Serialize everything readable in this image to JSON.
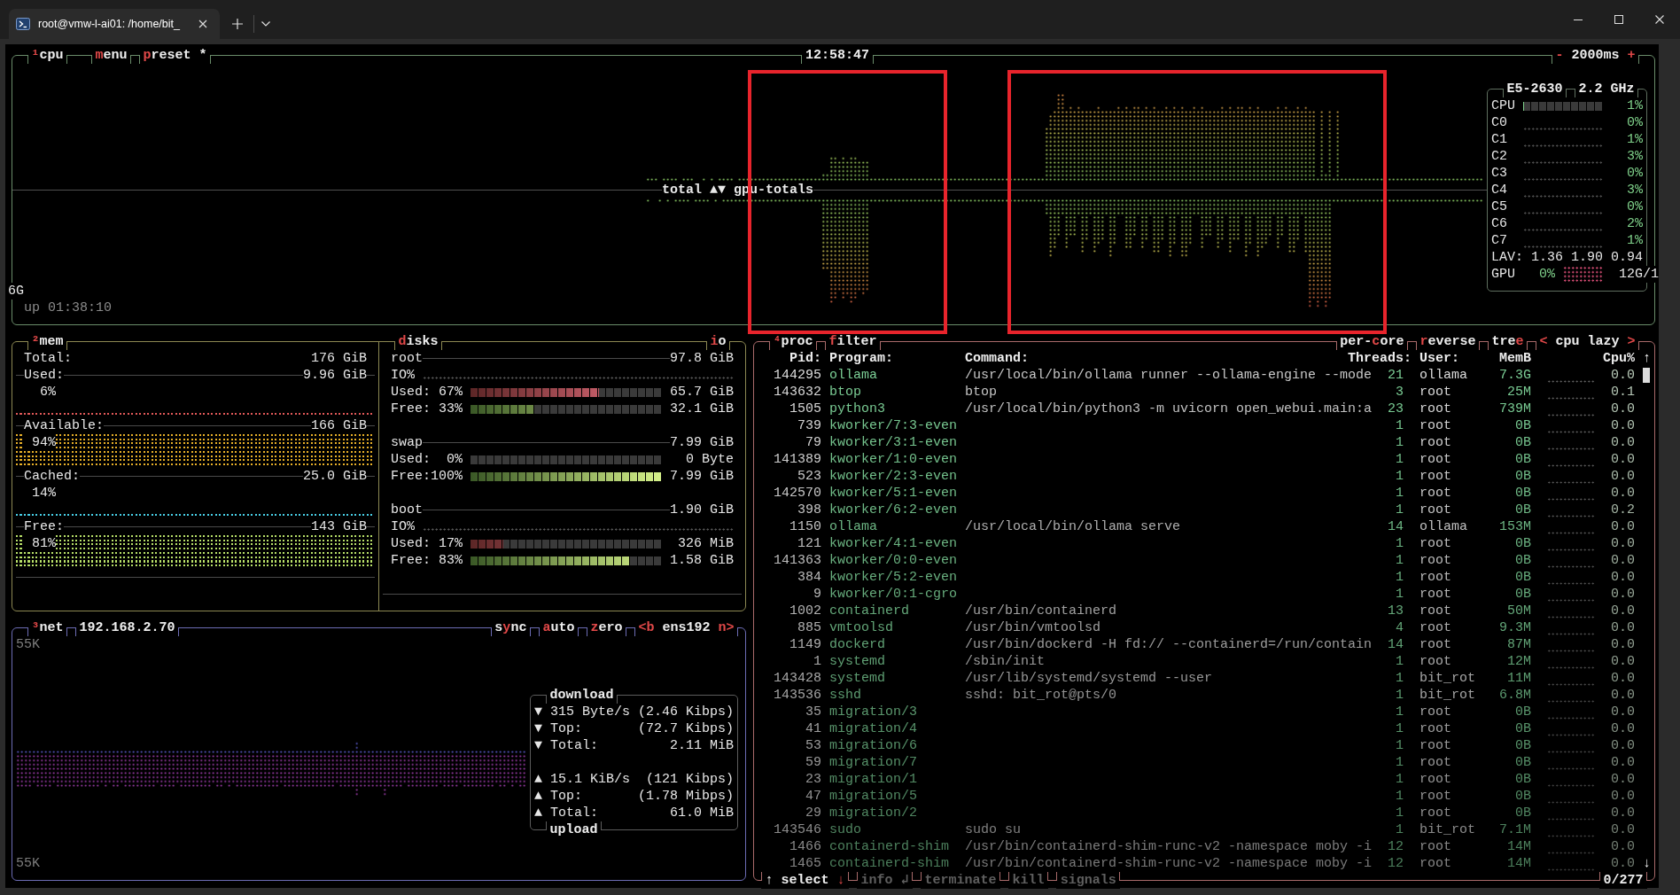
{
  "window": {
    "tabs": [
      {
        "title": "root@vmw-l-ai01: /home/bit_",
        "selected": true
      }
    ]
  },
  "cpu": {
    "titles": [
      {
        "parts": [
          {
            "text": "¹",
            "hot": true
          },
          {
            "text": "cpu",
            "hot": false
          }
        ]
      },
      {
        "parts": [
          {
            "text": "m",
            "hot": true
          },
          {
            "text": "enu",
            "hot": false
          }
        ]
      },
      {
        "parts": [
          {
            "text": "p",
            "hot": true
          },
          {
            "text": "reset *",
            "hot": false
          }
        ]
      }
    ],
    "clock": "12:58:47",
    "interval": {
      "parts": [
        {
          "text": "-",
          "hot": true
        },
        {
          "text": " 2000ms ",
          "hot": false
        },
        {
          "text": "+",
          "hot": true
        }
      ]
    },
    "graph": {
      "upper_label": "total",
      "toggle": "▲▼",
      "lower_label": "gpu-totals",
      "scale": "6G"
    },
    "uptime": "up 01:38:10",
    "model": "E5-2630",
    "frequency": "2.2 GHz",
    "total": {
      "label": "CPU",
      "level": 0.01,
      "percent": "1%"
    },
    "cores": [
      {
        "label": "C0",
        "percent": "0%"
      },
      {
        "label": "C1",
        "percent": "1%"
      },
      {
        "label": "C2",
        "percent": "3%"
      },
      {
        "label": "C3",
        "percent": "0%"
      },
      {
        "label": "C4",
        "percent": "3%"
      },
      {
        "label": "C5",
        "percent": "0%"
      },
      {
        "label": "C6",
        "percent": "2%"
      },
      {
        "label": "C7",
        "percent": "1%"
      }
    ],
    "load": {
      "label": "LAV:",
      "values": [
        "1.36",
        "1.90",
        "0.94"
      ]
    },
    "gpu": {
      "label": "GPU",
      "percent": "0%",
      "memory": "12G/1"
    }
  },
  "memory": {
    "title": {
      "parts": [
        {
          "text": "²",
          "hot": true
        },
        {
          "text": "mem",
          "hot": false
        }
      ]
    },
    "total": {
      "label": "Total:",
      "value": "176 GiB"
    },
    "meters": [
      {
        "label": "Used:",
        "value": "9.96 GiB",
        "percent": "6%",
        "color": "#e05858"
      },
      {
        "label": "Available:",
        "value": "166 GiB",
        "percent": "94%",
        "color": "#e8b028"
      },
      {
        "label": "Cached:",
        "value": "25.0 GiB",
        "percent": "14%",
        "color": "#48d0e8"
      },
      {
        "label": "Free:",
        "value": "143 GiB",
        "percent": "81%",
        "color": "#b8e068"
      }
    ]
  },
  "disks": {
    "title": {
      "parts": [
        {
          "text": "d",
          "hot": true
        },
        {
          "text": "isks",
          "hot": false
        }
      ]
    },
    "io_toggle": {
      "parts": [
        {
          "text": "i",
          "hot": true
        },
        {
          "text": "o",
          "hot": false
        }
      ]
    },
    "items": [
      {
        "name": "root",
        "size": "97.8 GiB",
        "io_label": "IO%",
        "bars": [
          {
            "kind": "used",
            "label": "Used:",
            "percent": "67%",
            "level": 0.67,
            "value": "65.7 GiB"
          },
          {
            "kind": "free",
            "label": "Free:",
            "percent": "33%",
            "level": 0.33,
            "value": "32.1 GiB"
          }
        ]
      },
      {
        "name": "swap",
        "size": "7.99 GiB",
        "bars": [
          {
            "kind": "used",
            "label": "Used:",
            "percent": "0%",
            "value": "0 Byte"
          },
          {
            "kind": "free",
            "label": "Free:",
            "percent": "100%",
            "level": 1,
            "value": "7.99 GiB"
          }
        ]
      },
      {
        "name": "boot",
        "size": "1.90 GiB",
        "io_label": "IO%",
        "bars": [
          {
            "kind": "used",
            "label": "Used:",
            "percent": "17%",
            "level": 0.17,
            "value": "326 MiB"
          },
          {
            "kind": "free",
            "label": "Free:",
            "percent": "83%",
            "level": 0.83,
            "value": "1.58 GiB"
          }
        ]
      }
    ]
  },
  "net": {
    "title": {
      "parts": [
        {
          "text": "³",
          "hot": true
        },
        {
          "text": "net",
          "hot": false
        }
      ]
    },
    "address": "192.168.2.70",
    "toggles": [
      {
        "parts": [
          {
            "text": "s",
            "hot": false
          },
          {
            "text": "y",
            "hot": true
          },
          {
            "text": "nc",
            "hot": false
          }
        ]
      },
      {
        "parts": [
          {
            "text": "a",
            "hot": true
          },
          {
            "text": "uto",
            "hot": false
          }
        ]
      },
      {
        "parts": [
          {
            "text": "z",
            "hot": true
          },
          {
            "text": "ero",
            "hot": false
          }
        ]
      },
      {
        "parts": [
          {
            "text": "<b",
            "hot": true
          },
          {
            "text": " ens192 ",
            "hot": false
          },
          {
            "text": "n>",
            "hot": true
          }
        ]
      }
    ],
    "scale_top": "55K",
    "scale_bottom": "55K",
    "download": {
      "title": "download",
      "rows": [
        {
          "arrow": "▼",
          "label": "315 Byte/s",
          "value": "(2.46 Kibps)"
        },
        {
          "arrow": "▼",
          "label": "Top:",
          "value": "(72.7 Kibps)"
        },
        {
          "arrow": "▼",
          "label": "Total:",
          "value": "2.11 MiB"
        }
      ]
    },
    "upload": {
      "title": "upload",
      "rows": [
        {
          "arrow": "▲",
          "label": "15.1 KiB/s",
          "value": "(121 Kibps)"
        },
        {
          "arrow": "▲",
          "label": "Top:",
          "value": "(1.78 Mibps)"
        },
        {
          "arrow": "▲",
          "label": "Total:",
          "value": "61.0 MiB"
        }
      ]
    }
  },
  "processes": {
    "titles_left": [
      {
        "parts": [
          {
            "text": "⁴",
            "hot": true
          },
          {
            "text": "proc",
            "hot": false
          }
        ]
      },
      {
        "parts": [
          {
            "text": "f",
            "hot": true
          },
          {
            "text": "ilter",
            "hot": false
          }
        ]
      }
    ],
    "titles_right": [
      {
        "parts": [
          {
            "text": "per-",
            "hot": false
          },
          {
            "text": "c",
            "hot": true
          },
          {
            "text": "ore",
            "hot": false
          }
        ]
      },
      {
        "parts": [
          {
            "text": "r",
            "hot": true
          },
          {
            "text": "everse",
            "hot": false
          }
        ]
      },
      {
        "parts": [
          {
            "text": "tre",
            "hot": false
          },
          {
            "text": "e",
            "hot": true
          }
        ]
      },
      {
        "parts": [
          {
            "text": "<",
            "hot": true
          },
          {
            "text": " cpu lazy ",
            "hot": false
          },
          {
            "text": ">",
            "hot": true
          }
        ]
      }
    ],
    "columns": [
      "Pid:",
      "Program:",
      "Command:",
      "Threads:",
      "User:",
      "MemB",
      "Cpu%"
    ],
    "scroll_up": "↑",
    "scroll_down": "↓",
    "rows": [
      {
        "pid": "144295",
        "program": "ollama",
        "command": "/usr/local/bin/ollama runner --ollama-engine --mode",
        "threads": "21",
        "user": "ollama",
        "mem": "7.3G",
        "cpu": "0.0"
      },
      {
        "pid": "143632",
        "program": "btop",
        "command": "btop",
        "threads": "3",
        "user": "root",
        "mem": "25M",
        "cpu": "0.1"
      },
      {
        "pid": "1505",
        "program": "python3",
        "command": "/usr/local/bin/python3 -m uvicorn open_webui.main:a",
        "threads": "23",
        "user": "root",
        "mem": "739M",
        "cpu": "0.0"
      },
      {
        "pid": "739",
        "program": "kworker/7:3-even",
        "threads": "1",
        "user": "root",
        "mem": "0B",
        "cpu": "0.0"
      },
      {
        "pid": "79",
        "program": "kworker/3:1-even",
        "threads": "1",
        "user": "root",
        "mem": "0B",
        "cpu": "0.0"
      },
      {
        "pid": "141389",
        "program": "kworker/1:0-even",
        "threads": "1",
        "user": "root",
        "mem": "0B",
        "cpu": "0.0"
      },
      {
        "pid": "523",
        "program": "kworker/2:3-even",
        "threads": "1",
        "user": "root",
        "mem": "0B",
        "cpu": "0.0"
      },
      {
        "pid": "142570",
        "program": "kworker/5:1-even",
        "threads": "1",
        "user": "root",
        "mem": "0B",
        "cpu": "0.0"
      },
      {
        "pid": "398",
        "program": "kworker/6:2-even",
        "threads": "1",
        "user": "root",
        "mem": "0B",
        "cpu": "0.2"
      },
      {
        "pid": "1150",
        "program": "ollama",
        "command": "/usr/local/bin/ollama serve",
        "threads": "14",
        "user": "ollama",
        "mem": "153M",
        "cpu": "0.0"
      },
      {
        "pid": "121",
        "program": "kworker/4:1-even",
        "threads": "1",
        "user": "root",
        "mem": "0B",
        "cpu": "0.0"
      },
      {
        "pid": "141363",
        "program": "kworker/0:0-even",
        "threads": "1",
        "user": "root",
        "mem": "0B",
        "cpu": "0.0"
      },
      {
        "pid": "384",
        "program": "kworker/5:2-even",
        "threads": "1",
        "user": "root",
        "mem": "0B",
        "cpu": "0.0"
      },
      {
        "pid": "9",
        "program": "kworker/0:1-cgro",
        "threads": "1",
        "user": "root",
        "mem": "0B",
        "cpu": "0.0"
      },
      {
        "pid": "1002",
        "program": "containerd",
        "command": "/usr/bin/containerd",
        "threads": "13",
        "user": "root",
        "mem": "50M",
        "cpu": "0.0"
      },
      {
        "pid": "885",
        "program": "vmtoolsd",
        "command": "/usr/bin/vmtoolsd",
        "threads": "4",
        "user": "root",
        "mem": "9.3M",
        "cpu": "0.0"
      },
      {
        "pid": "1149",
        "program": "dockerd",
        "command": "/usr/bin/dockerd -H fd:// --containerd=/run/contain",
        "threads": "14",
        "user": "root",
        "mem": "87M",
        "cpu": "0.0"
      },
      {
        "pid": "1",
        "program": "systemd",
        "command": "/sbin/init",
        "threads": "1",
        "user": "root",
        "mem": "12M",
        "cpu": "0.0"
      },
      {
        "pid": "143428",
        "program": "systemd",
        "command": "/usr/lib/systemd/systemd --user",
        "threads": "1",
        "user": "bit_rot",
        "mem": "11M",
        "cpu": "0.0"
      },
      {
        "pid": "143536",
        "program": "sshd",
        "command": "sshd: bit_rot@pts/0",
        "threads": "1",
        "user": "bit_rot",
        "mem": "6.8M",
        "cpu": "0.0"
      },
      {
        "pid": "35",
        "program": "migration/3",
        "threads": "1",
        "user": "root",
        "mem": "0B",
        "cpu": "0.0"
      },
      {
        "pid": "41",
        "program": "migration/4",
        "threads": "1",
        "user": "root",
        "mem": "0B",
        "cpu": "0.0"
      },
      {
        "pid": "53",
        "program": "migration/6",
        "threads": "1",
        "user": "root",
        "mem": "0B",
        "cpu": "0.0"
      },
      {
        "pid": "59",
        "program": "migration/7",
        "threads": "1",
        "user": "root",
        "mem": "0B",
        "cpu": "0.0"
      },
      {
        "pid": "23",
        "program": "migration/1",
        "threads": "1",
        "user": "root",
        "mem": "0B",
        "cpu": "0.0"
      },
      {
        "pid": "47",
        "program": "migration/5",
        "threads": "1",
        "user": "root",
        "mem": "0B",
        "cpu": "0.0"
      },
      {
        "pid": "29",
        "program": "migration/2",
        "threads": "1",
        "user": "root",
        "mem": "0B",
        "cpu": "0.0"
      },
      {
        "pid": "143546",
        "program": "sudo",
        "command": "sudo su",
        "threads": "1",
        "user": "bit_rot",
        "mem": "7.1M",
        "cpu": "0.0"
      },
      {
        "pid": "1466",
        "program": "containerd-shim",
        "command": "/usr/bin/containerd-shim-runc-v2 -namespace moby -i",
        "threads": "12",
        "user": "root",
        "mem": "14M",
        "cpu": "0.0"
      },
      {
        "pid": "1465",
        "program": "containerd-shim",
        "command": "/usr/bin/containerd-shim-runc-v2 -namespace moby -i",
        "threads": "12",
        "user": "root",
        "mem": "14M",
        "cpu": "0.0"
      }
    ],
    "footer": {
      "select": {
        "parts": [
          {
            "text": "↑",
            "hot": false
          },
          {
            "text": " select ",
            "hot": false
          },
          {
            "text": "↓",
            "hot": true
          }
        ]
      },
      "actions": [
        {
          "label": "info ↲",
          "disabled": true
        },
        {
          "label": "terminate",
          "disabled": true
        },
        {
          "label": "kill",
          "disabled": true
        },
        {
          "label": "signals",
          "disabled": true
        }
      ],
      "count": "0/277"
    }
  }
}
